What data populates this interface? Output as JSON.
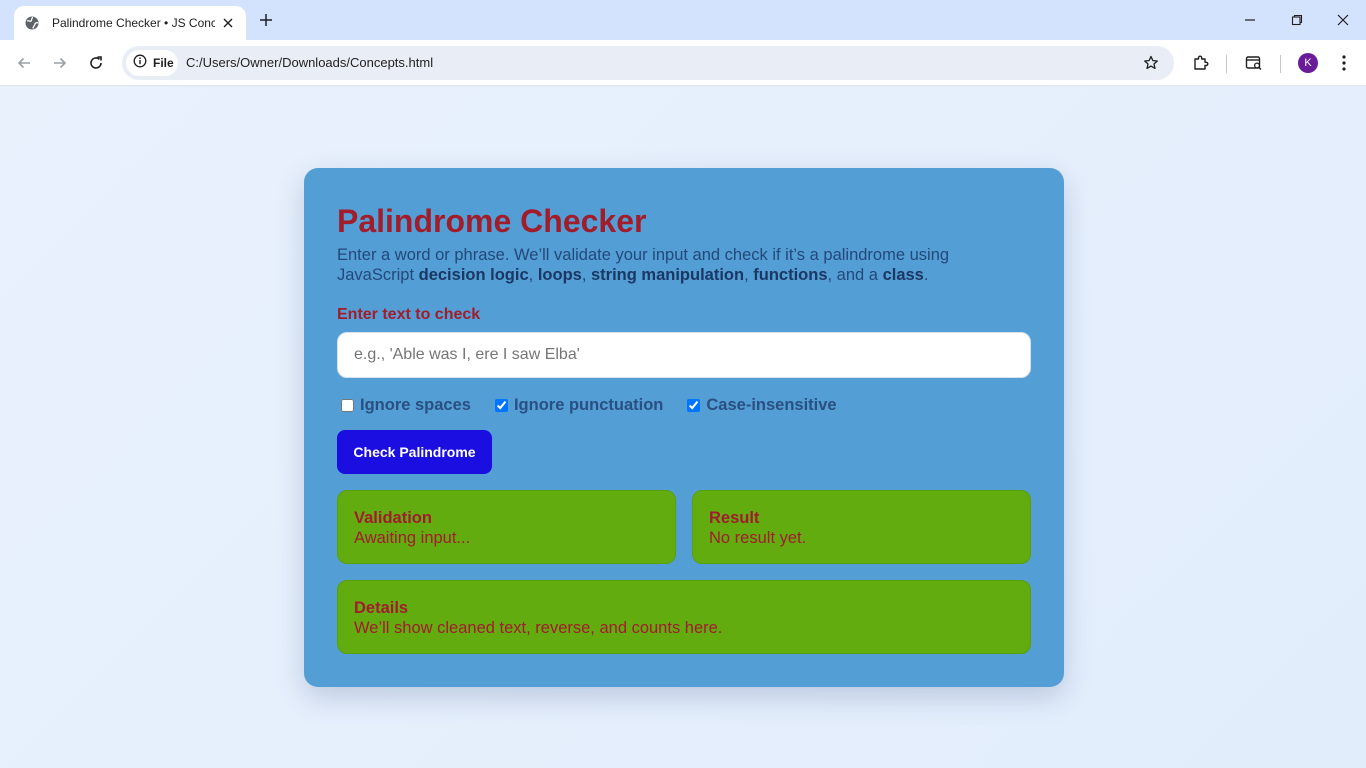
{
  "browser": {
    "tab_title": "Palindrome Checker • JS Concepts",
    "chip_label": "File",
    "url": "C:/Users/Owner/Downloads/Concepts.html",
    "profile_initial": "K"
  },
  "page": {
    "title": "Palindrome Checker",
    "subtitle": {
      "intro": "Enter a word or phrase. We’ll validate your input and check if it’s a palindrome using JavaScript ",
      "term1": "decision logic",
      "sep1": ", ",
      "term2": "loops",
      "sep2": ", ",
      "term3": "string manipulation",
      "sep3": ", ",
      "term4": "functions",
      "sep4": ", and a ",
      "term5": "class",
      "end": "."
    },
    "input_label": "Enter text to check",
    "input_placeholder": "e.g., 'Able was I, ere I saw Elba'",
    "input_value": "",
    "options": [
      {
        "label": "Ignore spaces",
        "checked": false
      },
      {
        "label": "Ignore punctuation",
        "checked": true
      },
      {
        "label": "Case-insensitive",
        "checked": true
      }
    ],
    "button_label": "Check Palindrome",
    "validation": {
      "title": "Validation",
      "text": "Awaiting input..."
    },
    "result": {
      "title": "Result",
      "text": "No result yet."
    },
    "details": {
      "title": "Details",
      "text": "We’ll show cleaned text, reverse, and counts here."
    }
  },
  "colors": {
    "card": "#539fd5",
    "title": "#a11d2b",
    "button": "#1b0ee0",
    "panel": "#63ac10"
  }
}
